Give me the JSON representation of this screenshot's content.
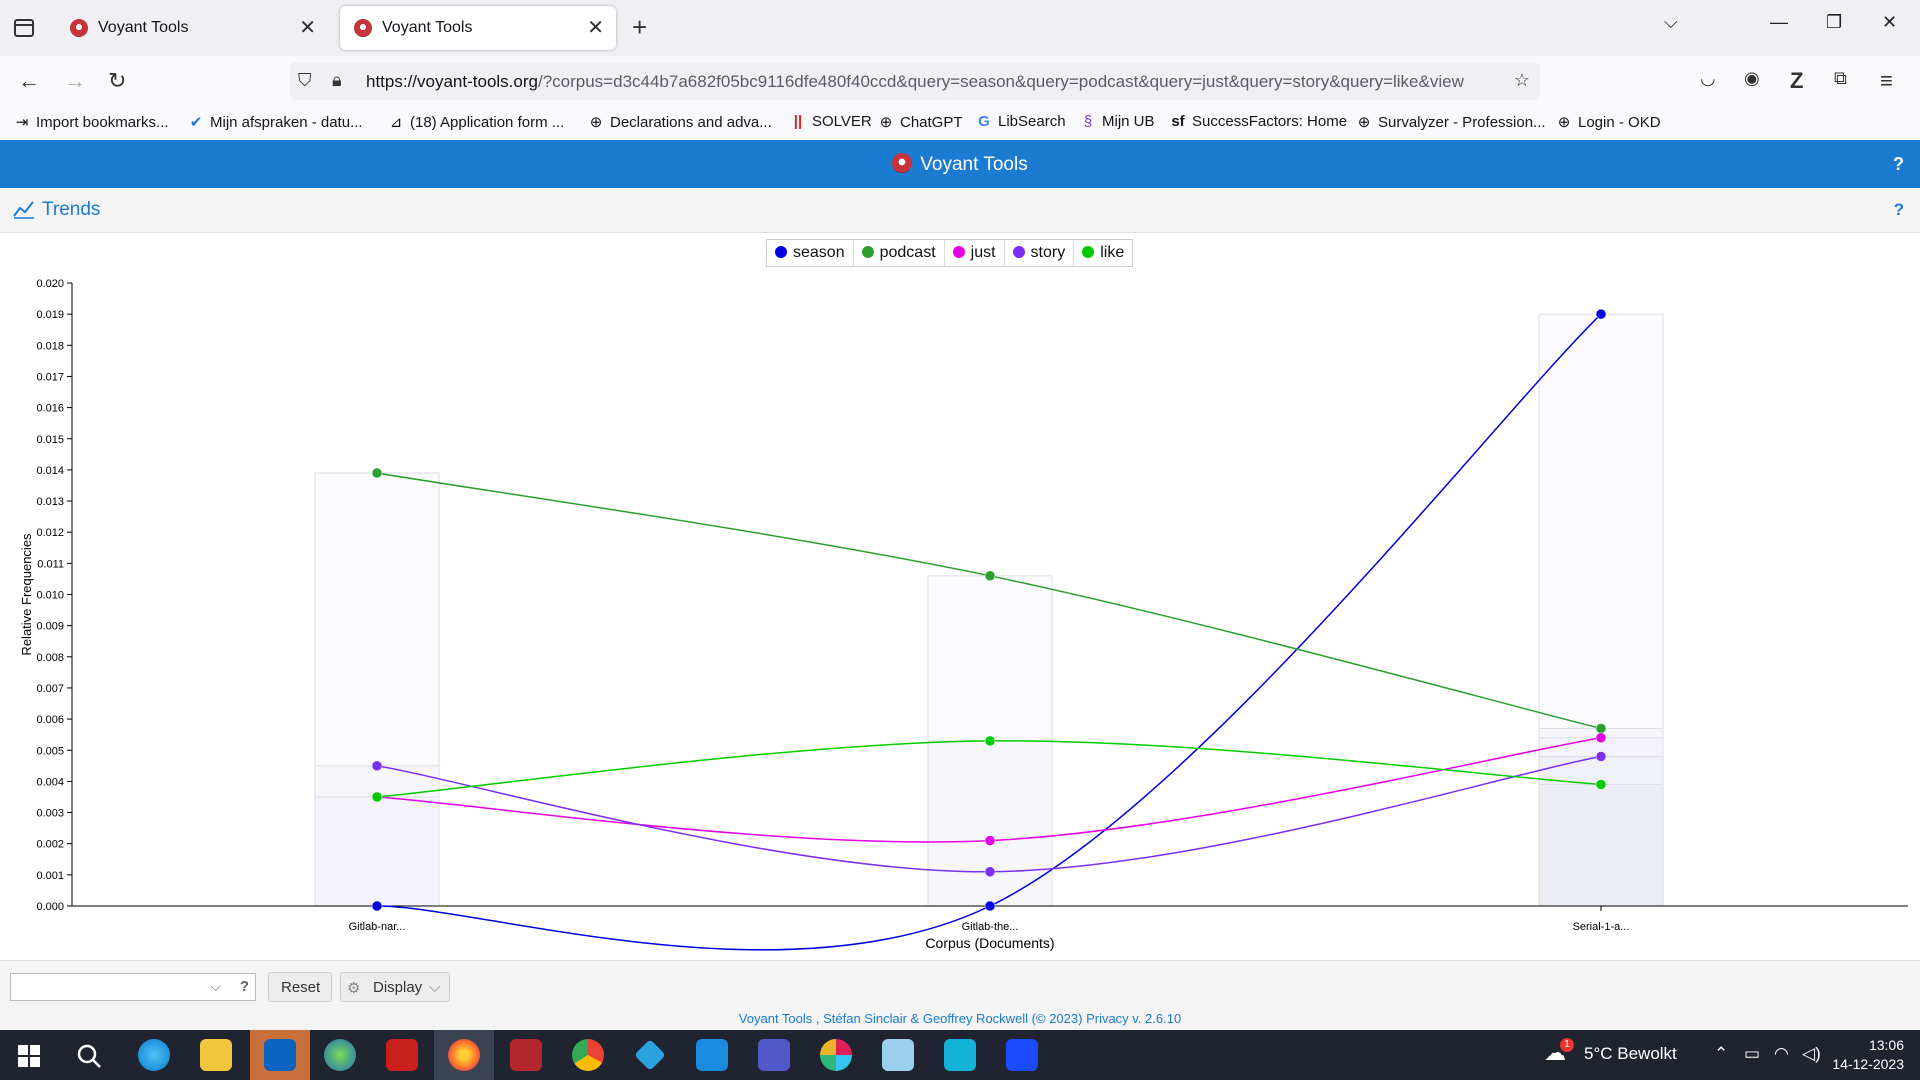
{
  "browser": {
    "tabs": [
      {
        "title": "Voyant Tools",
        "active": false
      },
      {
        "title": "Voyant Tools",
        "active": true
      }
    ],
    "url_host": "https://voyant-tools.org",
    "url_rest": "/?corpus=d3c44b7a682f05bc9116dfe480f40ccd&query=season&query=podcast&query=just&query=story&query=like&view",
    "bookmarks": [
      {
        "label": "Import bookmarks...",
        "icon": "import-icon"
      },
      {
        "label": "Mijn afspraken - datu...",
        "icon": "check-icon"
      },
      {
        "label": "(18) Application form ...",
        "icon": "form-icon"
      },
      {
        "label": "Declarations and adva...",
        "icon": "globe-icon"
      },
      {
        "label": "SOLVER",
        "icon": "solver-icon"
      },
      {
        "label": "ChatGPT",
        "icon": "globe-icon"
      },
      {
        "label": "LibSearch",
        "icon": "google-icon"
      },
      {
        "label": "Mijn UB",
        "icon": "ub-icon"
      },
      {
        "label": "SuccessFactors: Home",
        "icon": "sf-icon"
      },
      {
        "label": "Survalyzer - Profession...",
        "icon": "globe-icon"
      },
      {
        "label": "Login - OKD",
        "icon": "globe-icon"
      }
    ]
  },
  "app": {
    "title": "Voyant Tools",
    "help": "?",
    "panel_title": "Trends",
    "panel_help": "?"
  },
  "legend": [
    {
      "name": "season",
      "color": "#0000e0"
    },
    {
      "name": "podcast",
      "color": "#2ca02c"
    },
    {
      "name": "just",
      "color": "#e600e6"
    },
    {
      "name": "story",
      "color": "#7b2ff0"
    },
    {
      "name": "like",
      "color": "#00cc00"
    }
  ],
  "chart_data": {
    "type": "line",
    "xlabel": "Corpus (Documents)",
    "ylabel": "Relative Frequencies",
    "categories": [
      "Gitlab-nar...",
      "Gitlab-the...",
      "Serial-1-a..."
    ],
    "ylim": [
      0,
      0.02
    ],
    "yticks": [
      "0.000",
      "0.001",
      "0.002",
      "0.003",
      "0.004",
      "0.005",
      "0.006",
      "0.007",
      "0.008",
      "0.009",
      "0.010",
      "0.011",
      "0.012",
      "0.013",
      "0.014",
      "0.015",
      "0.016",
      "0.017",
      "0.018",
      "0.019",
      "0.020"
    ],
    "series": [
      {
        "name": "season",
        "color": "#0000e0",
        "values": [
          0.0,
          0.0,
          0.019
        ]
      },
      {
        "name": "podcast",
        "color": "#2ca02c",
        "values": [
          0.0139,
          0.0106,
          0.0057
        ]
      },
      {
        "name": "just",
        "color": "#e600e6",
        "values": [
          0.0035,
          0.0021,
          0.0054
        ]
      },
      {
        "name": "story",
        "color": "#7b2ff0",
        "values": [
          0.0045,
          0.0011,
          0.0048
        ]
      },
      {
        "name": "like",
        "color": "#00cc00",
        "values": [
          0.0035,
          0.0053,
          0.0039
        ]
      }
    ],
    "bars": [
      {
        "category": "Gitlab-nar...",
        "values": [
          0.0139,
          0.0045,
          0.0035
        ]
      },
      {
        "category": "Gitlab-the...",
        "values": [
          0.0106,
          0.0053
        ]
      },
      {
        "category": "Serial-1-a...",
        "values": [
          0.019,
          0.0057,
          0.0054,
          0.0048,
          0.0039
        ]
      }
    ]
  },
  "toolbar": {
    "reset_label": "Reset",
    "display_label": "Display",
    "help": "?"
  },
  "footer": {
    "text": "Voyant Tools , Stéfan Sinclair & Geoffrey Rockwell (© 2023) Privacy v. 2.6.10"
  },
  "taskbar": {
    "weather_badge": "1",
    "weather": "5°C  Bewolkt",
    "time": "13:06",
    "date": "14-12-2023"
  }
}
